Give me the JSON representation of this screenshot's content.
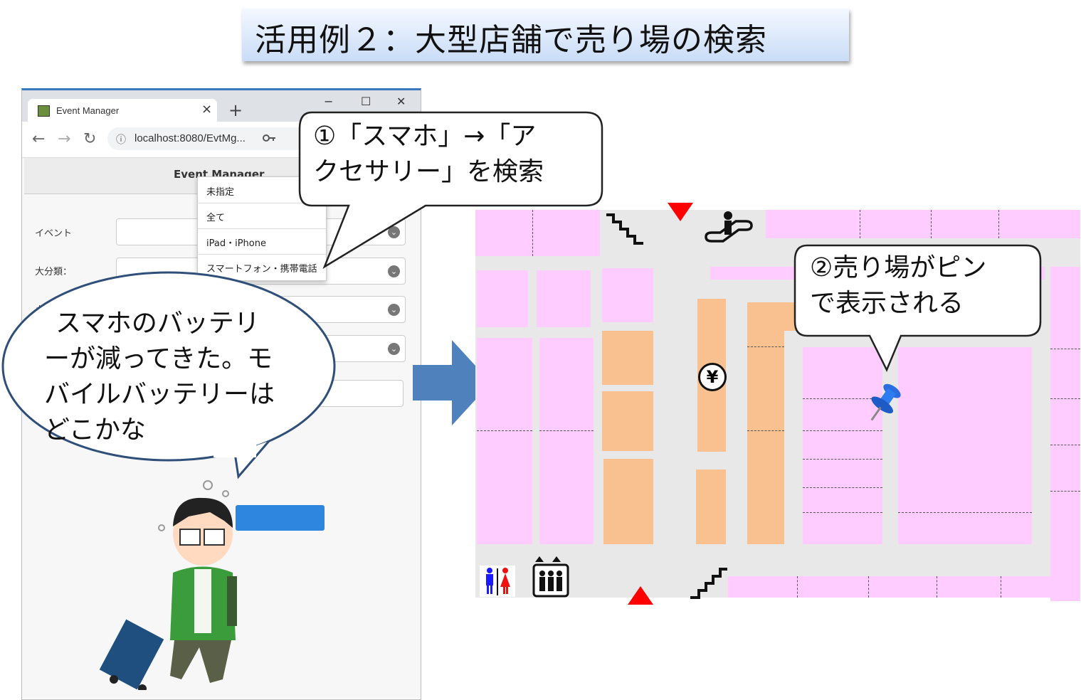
{
  "slide_title": "活用例２：大型店舗で売り場の検索",
  "browser": {
    "tab_title": "Event Manager",
    "tab_close": "×",
    "new_tab": "+",
    "window_minimize": "−",
    "window_maximize": "☐",
    "window_close": "✕",
    "nav_back": "←",
    "nav_forward": "→",
    "nav_reload": "↻",
    "url": "localhost:8080/EvtMg...",
    "info_icon": "ⓘ"
  },
  "app": {
    "header_title": "Event Manager",
    "fields": [
      {
        "label": "イベント"
      },
      {
        "label": "大分類："
      },
      {
        "label": "小分"
      }
    ],
    "dropdown_options": [
      "未指定",
      "全て",
      "iPad・iPhone",
      "スマートフォン・携帯電話"
    ]
  },
  "callout_search": "①「スマホ」→「アクセサリー」を検索",
  "callout_search_lines": [
    "①「スマホ」→「ア",
    "クセサリー」を検索"
  ],
  "thought_bubble_lines": [
    "スマホのバッテリ",
    "ーが減ってきた。モ",
    "バイルバッテリーは",
    "どこかな"
  ],
  "callout_pin_lines": [
    "②売り場がピン",
    "で表示される"
  ],
  "map": {
    "atm_symbol": "¥",
    "colors": {
      "shop": "#ffccff",
      "highlight": "#f9c18f",
      "corridor": "#e8e8e8",
      "entrance": "#ff0000",
      "pin": "#2a6de0"
    }
  }
}
